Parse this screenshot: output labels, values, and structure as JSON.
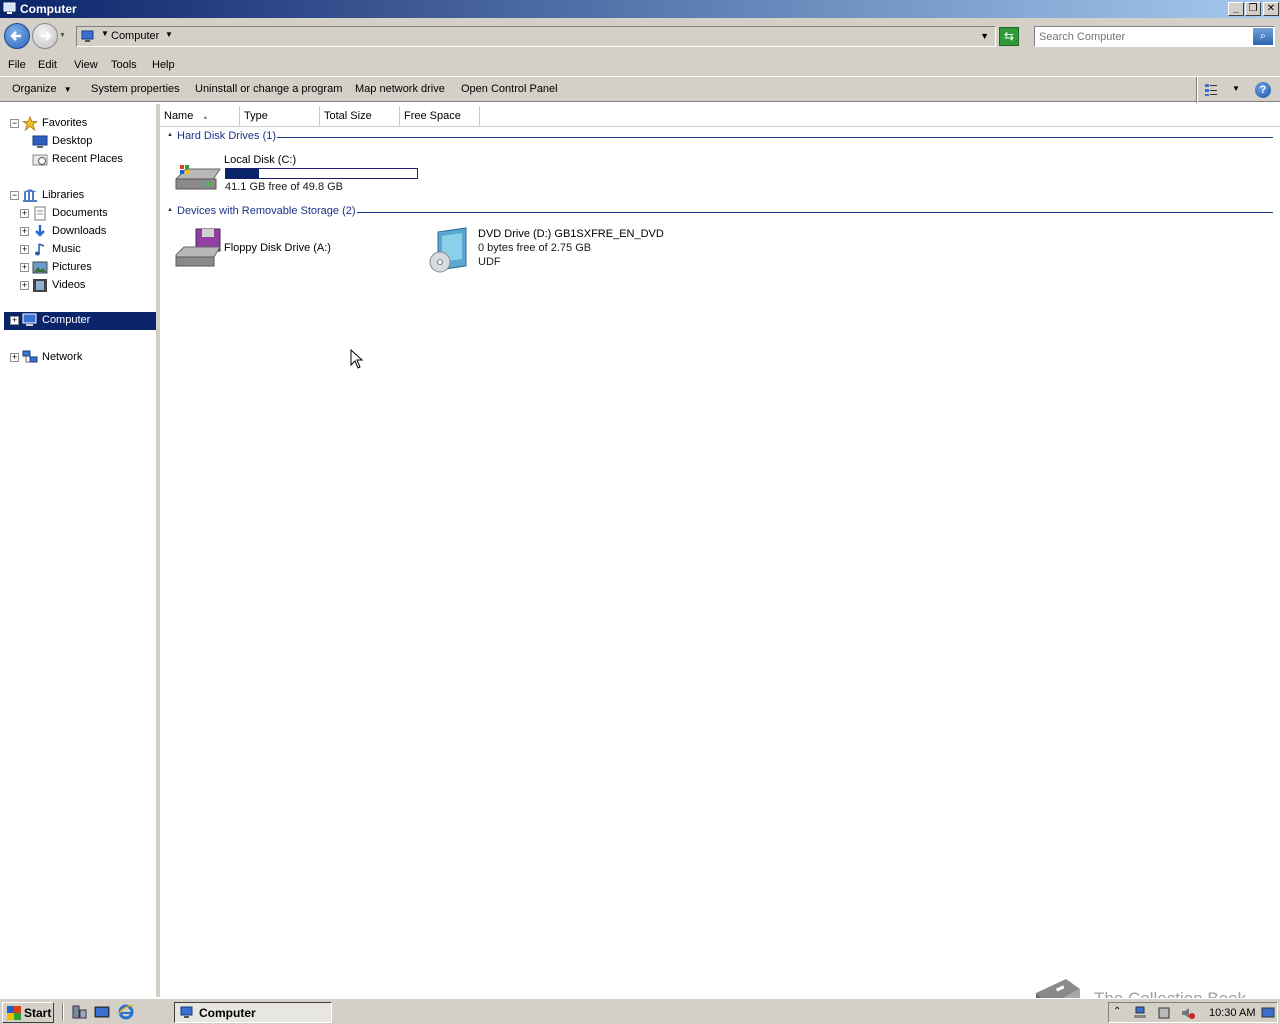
{
  "window": {
    "title": "Computer"
  },
  "address": {
    "path": "Computer"
  },
  "search": {
    "placeholder": "Search Computer"
  },
  "menu": {
    "file": "File",
    "edit": "Edit",
    "view": "View",
    "tools": "Tools",
    "help": "Help"
  },
  "commands": {
    "organize": "Organize",
    "system_properties": "System properties",
    "uninstall": "Uninstall or change a program",
    "map_drive": "Map network drive",
    "control_panel": "Open Control Panel"
  },
  "nav": {
    "favorites": "Favorites",
    "desktop": "Desktop",
    "recent": "Recent Places",
    "libraries": "Libraries",
    "documents": "Documents",
    "downloads": "Downloads",
    "music": "Music",
    "pictures": "Pictures",
    "videos": "Videos",
    "computer": "Computer",
    "network": "Network"
  },
  "columns": {
    "name": "Name",
    "type": "Type",
    "total": "Total Size",
    "free": "Free Space"
  },
  "groups": {
    "hdd": "Hard Disk Drives (1)",
    "removable": "Devices with Removable Storage (2)"
  },
  "drives": {
    "c": {
      "name": "Local Disk (C:)",
      "info": "41.1 GB free of 49.8 GB",
      "used_fraction": 0.175
    },
    "a": {
      "name": "Floppy Disk Drive (A:)"
    },
    "d": {
      "name": "DVD Drive (D:) GB1SXFRE_EN_DVD",
      "info": "0 bytes free of 2.75 GB",
      "fs": "UDF"
    }
  },
  "taskbar": {
    "start": "Start",
    "task": "Computer",
    "clock": "10:30 AM"
  },
  "watermark": "The Collection Book",
  "colors": {
    "title_start": "#0a246a",
    "title_end": "#a6caf0",
    "selection": "#0a246a",
    "group_text": "#1e3287"
  }
}
